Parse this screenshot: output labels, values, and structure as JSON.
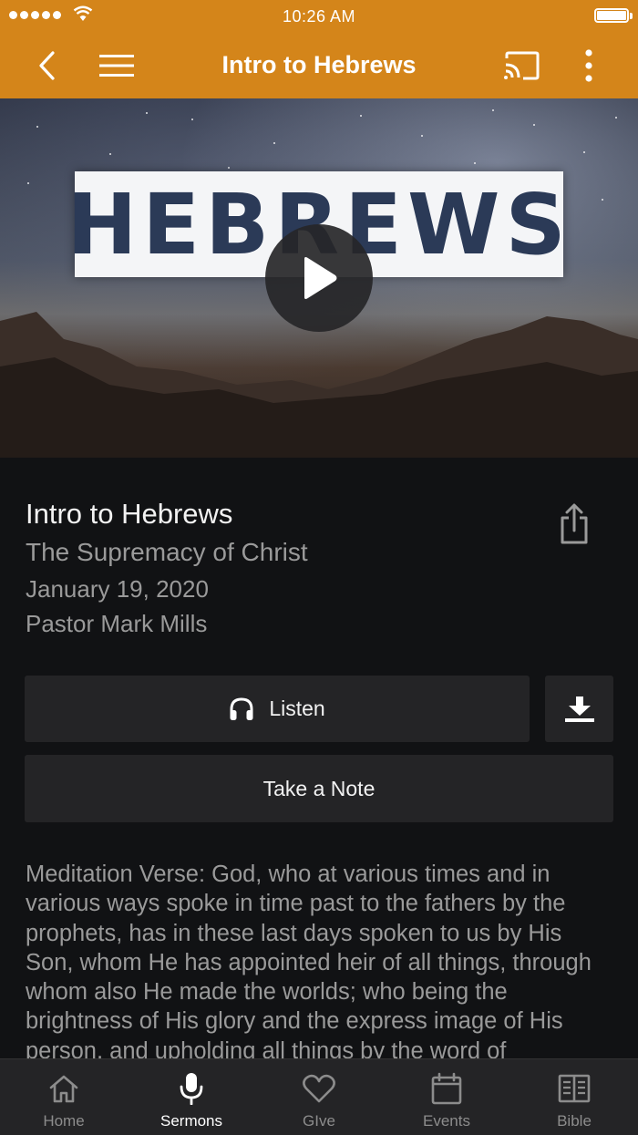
{
  "status_bar": {
    "time": "10:26 AM"
  },
  "header": {
    "title": "Intro to Hebrews"
  },
  "hero": {
    "banner_text": "HEBREWS"
  },
  "sermon": {
    "title": "Intro to Hebrews",
    "series": "The Supremacy of Christ",
    "date": "January 19, 2020",
    "speaker": "Pastor Mark Mills",
    "description": "Meditation Verse: God, who at various times and in various ways spoke in time past to the fathers by the prophets, has in these last days spoken to us by His Son, whom He has appointed heir of all things, through whom also He made the worlds; who being the brightness of His glory and the express image of His person, and upholding all things by the word of"
  },
  "actions": {
    "listen_label": "Listen",
    "note_label": "Take a Note"
  },
  "tabs": [
    {
      "label": "Home",
      "icon": "home-icon",
      "active": false
    },
    {
      "label": "Sermons",
      "icon": "microphone-icon",
      "active": true
    },
    {
      "label": "GIve",
      "icon": "heart-icon",
      "active": false
    },
    {
      "label": "Events",
      "icon": "calendar-icon",
      "active": false
    },
    {
      "label": "Bible",
      "icon": "book-icon",
      "active": false
    }
  ],
  "colors": {
    "accent": "#d4851a",
    "background": "#111214",
    "button": "#242426",
    "muted_text": "#9a9a9a"
  }
}
